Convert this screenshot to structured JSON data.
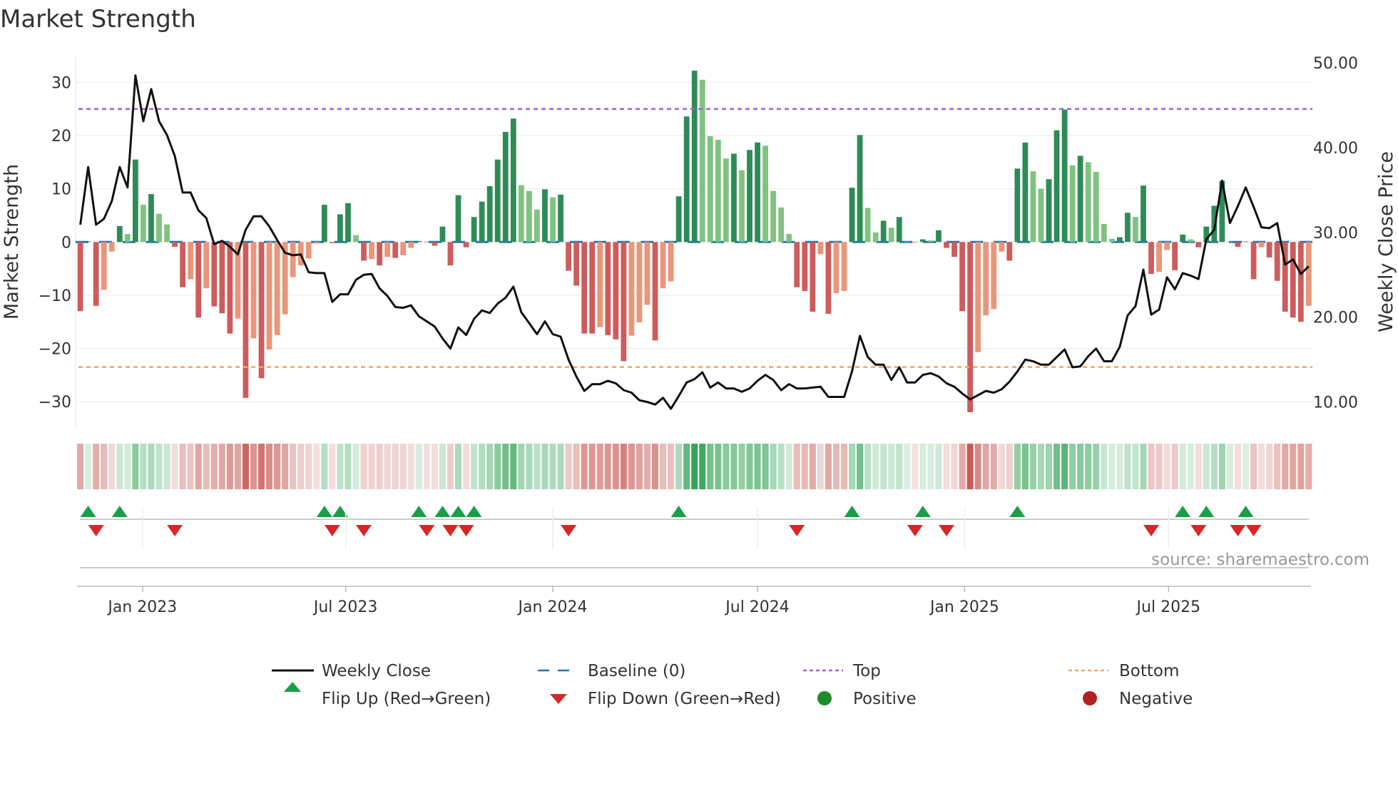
{
  "chart_data": {
    "type": "bar",
    "title": "Market Strength",
    "ylabel": "Market Strength",
    "y2label": "Weekly Close Price",
    "ylim": [
      -35,
      35
    ],
    "y2lim": [
      7,
      52
    ],
    "yticks": [
      "30",
      "20",
      "10",
      "0",
      "−10",
      "−20",
      "−30"
    ],
    "ytick_values": [
      30,
      20,
      10,
      0,
      -10,
      -20,
      -30
    ],
    "y2ticks": [
      "50.00",
      "40.00",
      "30.00",
      "20.00",
      "10.00"
    ],
    "y2tick_values": [
      50,
      40,
      30,
      20,
      10
    ],
    "x_unit": "week index",
    "xticks": [
      {
        "label": "Jan 2023",
        "week": 7.9
      },
      {
        "label": "Jul 2023",
        "week": 33.7
      },
      {
        "label": "Jan 2024",
        "week": 60.0
      },
      {
        "label": "Jul 2024",
        "week": 86.0
      },
      {
        "label": "Jan 2025",
        "week": 112.3
      },
      {
        "label": "Jul 2025",
        "week": 138.2
      }
    ],
    "top_level": 25,
    "bottom_level": -23.5,
    "baseline": 0,
    "strength": [
      -13,
      0.1,
      -12,
      -9,
      -1.8,
      3,
      1.5,
      15.5,
      7,
      9,
      5.3,
      3.3,
      -0.9,
      -8.5,
      -7,
      -14.2,
      -8.7,
      -12.1,
      -13.4,
      -17.2,
      -14.4,
      -29.3,
      -18.1,
      -25.6,
      -20.2,
      -17.5,
      -13.6,
      -6.6,
      -4.4,
      -3.1,
      -0.3,
      7,
      -0.2,
      5.2,
      7.3,
      1.3,
      -3.5,
      -3.2,
      -4.4,
      -2.8,
      -3.0,
      -2.5,
      -1.1,
      0.2,
      -0.1,
      -0.7,
      2.9,
      -4.4,
      8.8,
      -1.0,
      4.7,
      7.6,
      10.5,
      15.5,
      20.7,
      23.2,
      10.7,
      9.6,
      6.1,
      9.9,
      8.4,
      8.9,
      -5.4,
      -8.2,
      -17.2,
      -17.2,
      -16.0,
      -17.5,
      -18.3,
      -22.4,
      -17.6,
      -15.1,
      -11.8,
      -18.5,
      -8.7,
      -7.4,
      8.6,
      23.6,
      32.2,
      30.5,
      19.9,
      19.2,
      15.7,
      16.6,
      13.5,
      17.3,
      18.7,
      18.1,
      9.6,
      6.5,
      1.5,
      -8.5,
      -9.2,
      -13.1,
      -2.3,
      -13.5,
      -9.6,
      -9.2,
      10.2,
      20.1,
      6.4,
      1.8,
      4.0,
      2.7,
      4.7,
      0.1,
      -0.1,
      0.5,
      0.3,
      2.2,
      -1.1,
      -2.8,
      -13.0,
      -32,
      -20.7,
      -13.8,
      -12.6,
      -1.8,
      -3.5,
      13.8,
      18.7,
      13.3,
      10.0,
      11.8,
      21.0,
      24.9,
      14.4,
      16.2,
      15.0,
      13.2,
      3.4,
      0.6,
      0.9,
      5.5,
      4.7,
      10.6,
      -6.0,
      -5.6,
      -1.5,
      -5.3,
      1.4,
      0.5,
      -1.0,
      2.9,
      6.8,
      11.5,
      0.1,
      -0.9,
      0.1,
      -7.0,
      -1.0,
      -2.9,
      -7.3,
      -13.1,
      -14.2,
      -15.0,
      -12.0
    ],
    "weekly_close": [
      30.9,
      37.7,
      30.9,
      31.6,
      33.7,
      37.7,
      35.3,
      48.5,
      43.1,
      46.9,
      43.1,
      41.5,
      39.0,
      34.7,
      34.7,
      32.6,
      31.7,
      28.6,
      29.0,
      28.3,
      27.4,
      30.3,
      31.9,
      31.9,
      30.7,
      29.1,
      27.6,
      27.3,
      27.4,
      25.3,
      25.2,
      25.2,
      21.8,
      22.7,
      22.7,
      24.4,
      25.0,
      25.1,
      23.4,
      22.5,
      21.2,
      21.1,
      21.4,
      20.1,
      19.5,
      18.9,
      17.5,
      16.3,
      18.8,
      17.9,
      19.8,
      20.8,
      20.5,
      21.6,
      22.3,
      23.6,
      20.6,
      19.3,
      18.0,
      19.5,
      18.0,
      17.7,
      15.0,
      13.0,
      11.3,
      12.1,
      12.1,
      12.5,
      12.2,
      11.4,
      11.1,
      10.2,
      10.0,
      9.7,
      10.5,
      9.2,
      10.7,
      12.3,
      12.7,
      13.5,
      11.7,
      12.3,
      11.6,
      11.6,
      11.2,
      11.6,
      12.5,
      13.2,
      12.6,
      11.4,
      12.1,
      11.6,
      11.6,
      11.7,
      11.8,
      10.6,
      10.6,
      10.6,
      13.6,
      17.8,
      15.3,
      14.4,
      14.4,
      12.6,
      14.1,
      12.3,
      12.3,
      13.2,
      13.4,
      13.0,
      12.2,
      11.8,
      11.0,
      10.3,
      10.8,
      11.3,
      11.1,
      11.5,
      12.4,
      13.6,
      15.0,
      14.8,
      14.4,
      14.4,
      15.3,
      16.2,
      14.1,
      14.2,
      15.4,
      16.3,
      14.8,
      14.8,
      16.5,
      20.2,
      21.3,
      25.6,
      20.3,
      20.9,
      24.7,
      23.3,
      25.2,
      24.9,
      24.5,
      29.2,
      30.3,
      36.1,
      31.1,
      33.1,
      35.3,
      33.0,
      30.6,
      30.5,
      31.1,
      26.2,
      26.8,
      25.1,
      26.0
    ],
    "flip_up_weeks": [
      1,
      5,
      31,
      33,
      43,
      46,
      48,
      50,
      76,
      98,
      107,
      119,
      140,
      143,
      148
    ],
    "flip_down_weeks": [
      2,
      12,
      32,
      36,
      44,
      47,
      49,
      62,
      91,
      106,
      110,
      136,
      142,
      147,
      149
    ],
    "legend": {
      "placement": "bottom",
      "entries": [
        "Weekly Close",
        "Baseline (0)",
        "Top",
        "Bottom",
        "Flip Up (Red→Green)",
        "Flip Down (Green→Red)",
        "Positive",
        "Negative"
      ]
    },
    "source": "source: sharemaestro.com"
  },
  "colors": {
    "pos_strong": "#2e8b57",
    "pos_weak": "#81c281",
    "neg_strong": "#cd5c5c",
    "neg_weak": "#e9967a",
    "baseline": "#1f77b4",
    "top": "#9467dd",
    "bottom": "#f4a460",
    "line": "#111111",
    "flip_up": "#1a9e48",
    "flip_down": "#d62728",
    "positive": "#1f8a2a",
    "negative": "#b22222"
  }
}
